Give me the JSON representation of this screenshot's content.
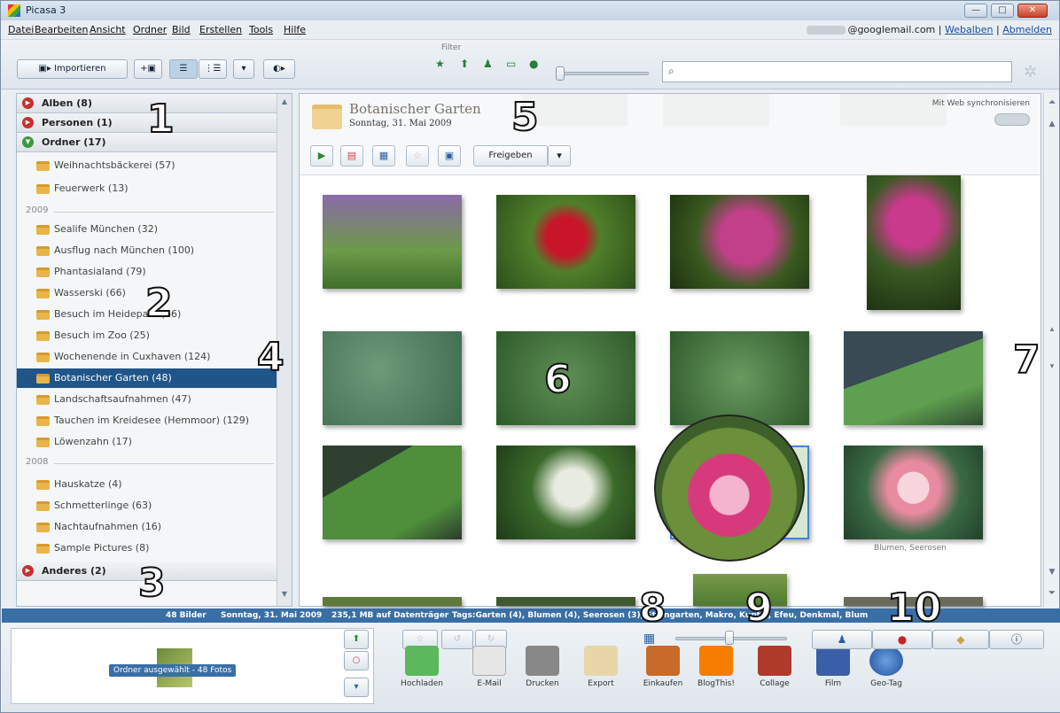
{
  "window": {
    "title": "Picasa 3",
    "min": "—",
    "max": "□",
    "close": "✕"
  },
  "menu": [
    "Datei",
    "Bearbeiten",
    "Ansicht",
    "Ordner",
    "Bild",
    "Erstellen",
    "Tools",
    "Hilfe"
  ],
  "account": {
    "email": "@googlemail.com",
    "web": "Webalben",
    "logout": "Abmelden",
    "sep": "|"
  },
  "toolbar": {
    "import": "Importieren",
    "filter_label": "Filter",
    "search_placeholder": ""
  },
  "sidebar": {
    "sections": {
      "albums": "Alben (8)",
      "people": "Personen (1)",
      "folders": "Ordner (17)",
      "other": "Anderes (2)"
    },
    "folders_top": [
      "Weihnachtsbäckerei (57)",
      "Feuerwerk (13)"
    ],
    "year1": "2009",
    "folders_2009": [
      "Sealife München (32)",
      "Ausflug nach München (100)",
      "Phantasialand (79)",
      "Wasserski (66)",
      "Besuch im Heidepark (66)",
      "Besuch im Zoo (25)",
      "Wochenende in Cuxhaven (124)",
      "Botanischer Garten (48)",
      "Landschaftsaufnahmen (47)",
      "Tauchen im Kreidesee (Hemmoor) (129)",
      "Löwenzahn (17)"
    ],
    "year2": "2008",
    "folders_2008": [
      "Hauskatze (4)",
      "Schmetterlinge (63)",
      "Nachtaufnahmen (16)",
      "Sample Pictures (8)"
    ]
  },
  "album": {
    "title": "Botanischer Garten",
    "date": "Sonntag, 31. Mai 2009",
    "sync": "Mit Web synchronisieren",
    "share": "Freigeben"
  },
  "caption": "Blumen, Seerosen",
  "markers": [
    "1",
    "2",
    "3",
    "4",
    "5",
    "6",
    "7",
    "8",
    "9",
    "10"
  ],
  "status": {
    "count": "48 Bilder",
    "date": "Sonntag, 31. Mai 2009",
    "size": "235,1 MB auf Datenträger",
    "tags": "Tags:Garten (4), Blumen (4), Seerosen (3), Steingarten, Makro, Kupfer, Efeu, Denkmal, Blum"
  },
  "tray": {
    "label": "Ordner ausgewählt - 48 Fotos"
  },
  "actions": [
    "Hochladen",
    "E-Mail",
    "Drucken",
    "Export",
    "Einkaufen",
    "BlogThis!",
    "Collage",
    "Film",
    "Geo-Tag"
  ],
  "colors": {
    "selection": "#205589",
    "status": "#3a6fa6"
  }
}
